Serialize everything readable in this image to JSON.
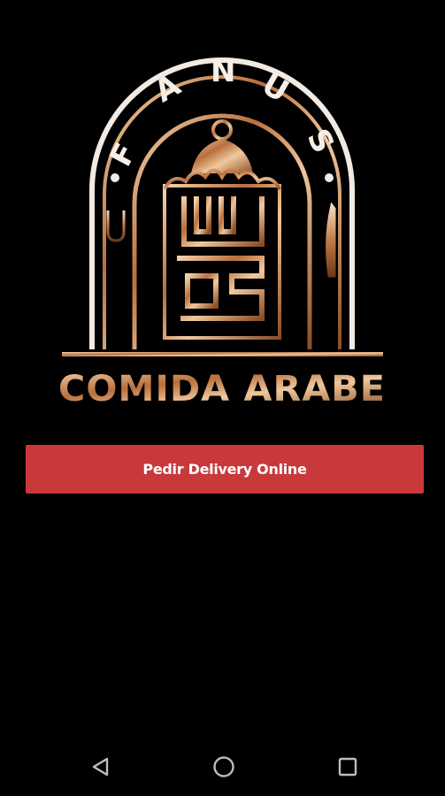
{
  "logo": {
    "brand_letters": [
      "F",
      "A",
      "N",
      "U",
      "S"
    ],
    "tagline": "COMIDA ARABE"
  },
  "actions": {
    "delivery_button_label": "Pedir Delivery Online"
  },
  "colors": {
    "background": "#000000",
    "accent": "#c9393b",
    "logo_gold": "#c98a5a"
  },
  "navbar": {
    "back_icon": "back-triangle-icon",
    "home_icon": "home-circle-icon",
    "recents_icon": "recents-square-icon"
  }
}
